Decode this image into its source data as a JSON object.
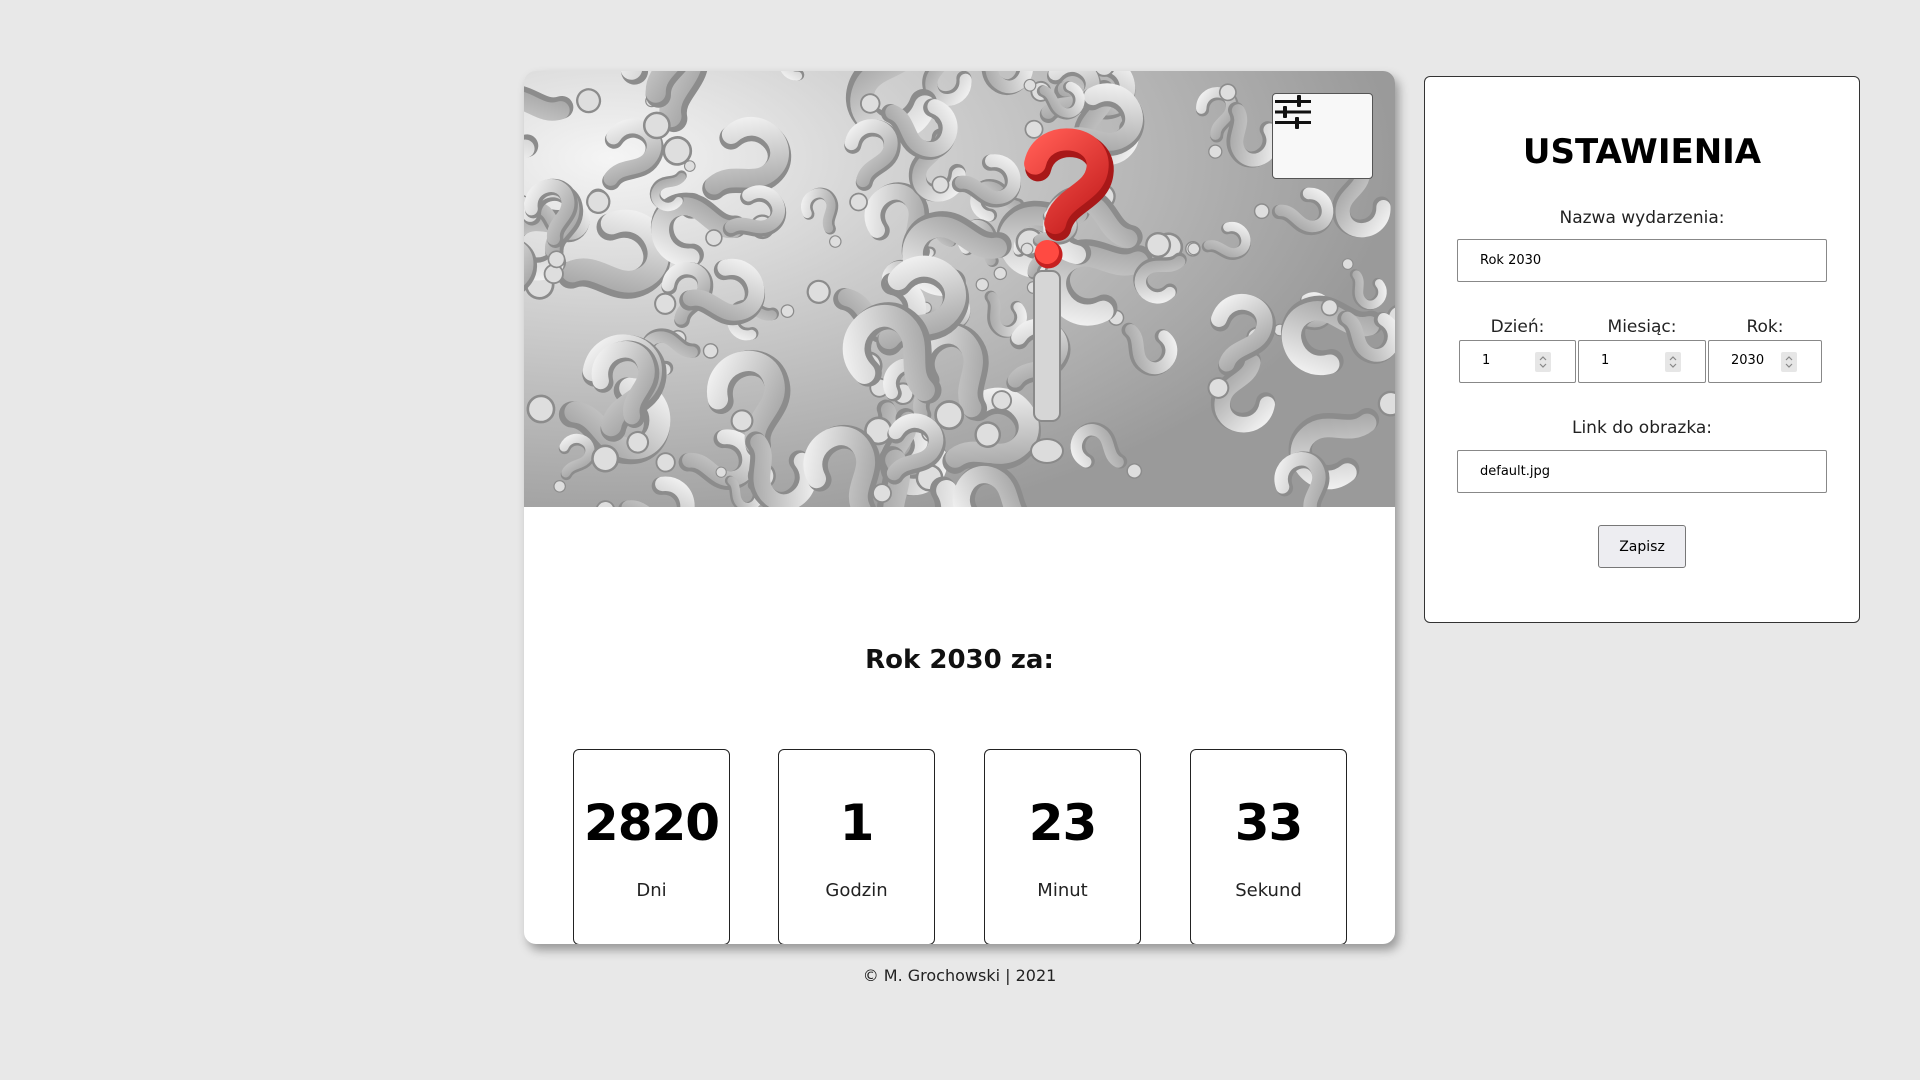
{
  "countdown": {
    "event_title": "Rok 2030 za:",
    "toggle_icon": "sliders-icon",
    "hero_image": "question-marks-image",
    "units": [
      {
        "value": "2820",
        "label": "Dni"
      },
      {
        "value": "1",
        "label": "Godzin"
      },
      {
        "value": "23",
        "label": "Minut"
      },
      {
        "value": "33",
        "label": "Sekund"
      }
    ]
  },
  "footer": {
    "text": "© M. Grochowski | 2021"
  },
  "settings": {
    "title": "USTAWIENIA",
    "event_name_label": "Nazwa wydarzenia:",
    "event_name_value": "Rok 2030",
    "day_label": "Dzień:",
    "day_value": "1",
    "month_label": "Miesiąc:",
    "month_value": "1",
    "year_label": "Rok:",
    "year_value": "2030",
    "image_link_label": "Link do obrazka:",
    "image_link_value": "default.jpg",
    "save_label": "Zapisz"
  },
  "colors": {
    "page_background": "#e8e8e8",
    "card_background": "#ffffff",
    "accent_red": "#e53935"
  }
}
